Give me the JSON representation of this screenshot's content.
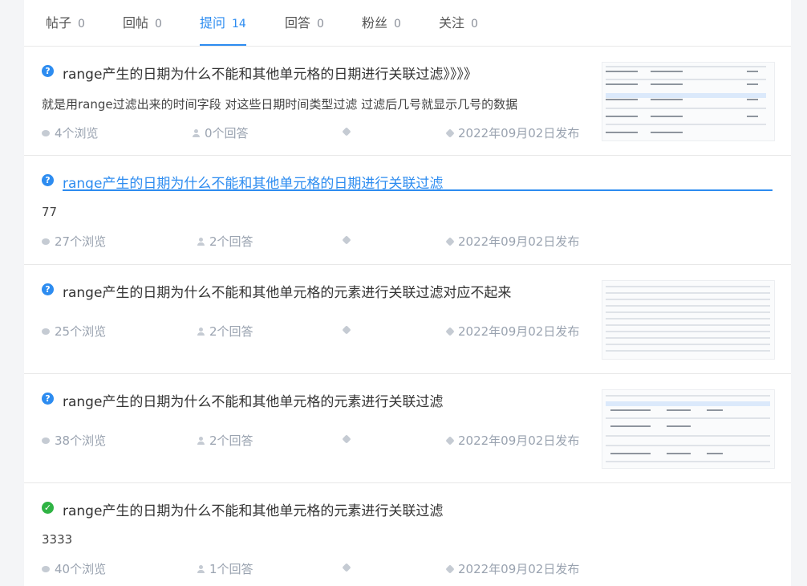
{
  "tabs": [
    {
      "label": "帖子",
      "count": "0"
    },
    {
      "label": "回帖",
      "count": "0"
    },
    {
      "label": "提问",
      "count": "14"
    },
    {
      "label": "回答",
      "count": "0"
    },
    {
      "label": "粉丝",
      "count": "0"
    },
    {
      "label": "关注",
      "count": "0"
    }
  ],
  "questions": [
    {
      "status": "unsolved",
      "title": "range产生的日期为什么不能和其他单元格的日期进行关联过滤》》》》",
      "desc": "就是用range过滤出来的时间字段 对这些日期时间类型过滤 过滤后几号就显示几号的数据",
      "views": "4个浏览",
      "answers": "0个回答",
      "date": "2022年09月02日发布"
    },
    {
      "status": "unsolved",
      "title": "range产生的日期为什么不能和其他单元格的日期进行关联过滤",
      "desc": "77",
      "views": "27个浏览",
      "answers": "2个回答",
      "date": "2022年09月02日发布"
    },
    {
      "status": "unsolved",
      "title": "range产生的日期为什么不能和其他单元格的元素进行关联过滤对应不起来",
      "desc": "",
      "views": "25个浏览",
      "answers": "2个回答",
      "date": "2022年09月02日发布"
    },
    {
      "status": "unsolved",
      "title": "range产生的日期为什么不能和其他单元格的元素进行关联过滤",
      "desc": "",
      "views": "38个浏览",
      "answers": "2个回答",
      "date": "2022年09月02日发布"
    },
    {
      "status": "solved",
      "title": "range产生的日期为什么不能和其他单元格的元素进行关联过滤",
      "desc": "3333",
      "views": "40个浏览",
      "answers": "1个回答",
      "date": "2022年09月02日发布"
    }
  ],
  "colors": {
    "accent": "#2d8cf0",
    "solved": "#2fb344",
    "meta": "#9aa3b0"
  },
  "icons": {
    "question": "question-circle-icon",
    "solved": "check-circle-icon",
    "views": "eye-icon",
    "answers": "user-icon",
    "tag": "tag-icon"
  }
}
